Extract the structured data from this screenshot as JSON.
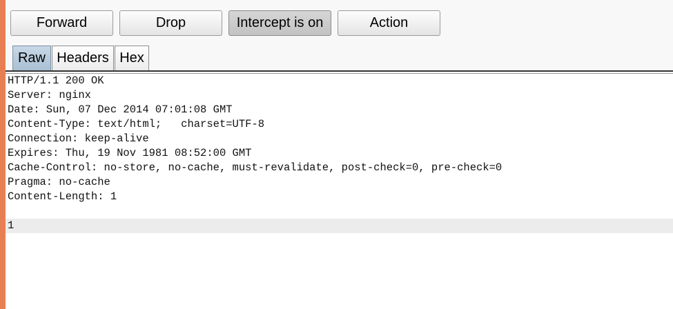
{
  "toolbar": {
    "forward_label": "Forward",
    "drop_label": "Drop",
    "intercept_label": "Intercept is on",
    "action_label": "Action"
  },
  "tabs": [
    {
      "label": "Raw",
      "selected": true
    },
    {
      "label": "Headers",
      "selected": false
    },
    {
      "label": "Hex",
      "selected": false
    }
  ],
  "editor": {
    "lines": [
      "HTTP/1.1 200 OK",
      "Server: nginx",
      "Date: Sun, 07 Dec 2014 07:01:08 GMT",
      "Content-Type: text/html;   charset=UTF-8",
      "Connection: keep-alive",
      "Expires: Thu, 19 Nov 1981 08:52:00 GMT",
      "Cache-Control: no-store, no-cache, must-revalidate, post-check=0, pre-check=0",
      "Pragma: no-cache",
      "Content-Length: 1",
      "",
      "1"
    ]
  },
  "colors": {
    "accent_edge": "#e87f52",
    "selected_tab": "#a9bfd3",
    "current_line": "#ececec"
  }
}
